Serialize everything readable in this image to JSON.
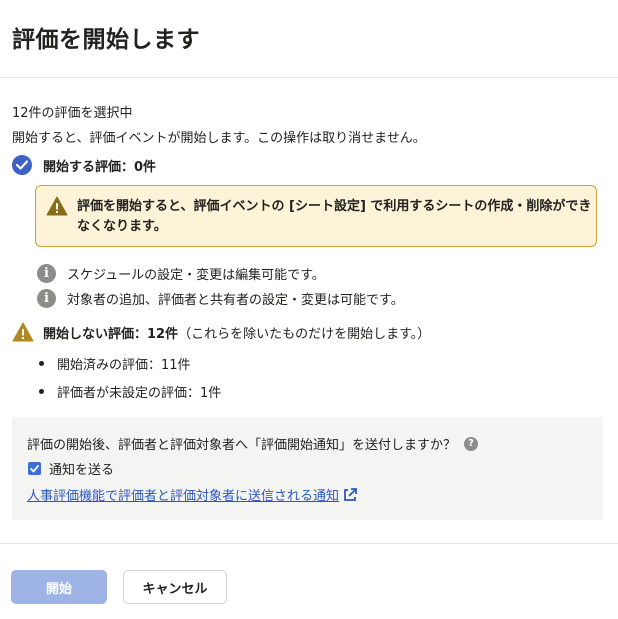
{
  "dialog": {
    "title": "評価を開始します"
  },
  "summary": {
    "selected": "12件の評価を選択中",
    "description": "開始すると、評価イベントが開始します。この操作は取り消せません。"
  },
  "start_section": {
    "label": "開始する評価：0件",
    "alert": "評価を開始すると、評価イベントの [シート設定] で利用するシートの作成・削除ができなくなります。",
    "notes": [
      "スケジュールの設定・変更は編集可能です。",
      "対象者の追加、評価者と共有者の設定・変更は可能です。"
    ]
  },
  "skip_section": {
    "label": "開始しない評価：12件",
    "note": "（これらを除いたものだけを開始します。）",
    "items": [
      "開始済みの評価：11件",
      "評価者が未設定の評価：1件"
    ]
  },
  "notify": {
    "question": "評価の開始後、評価者と評価対象者へ「評価開始通知」を送付しますか？",
    "checkbox_label": "通知を送る",
    "checked": true,
    "link_text": "人事評価機能で評価者と評価対象者に送信される通知"
  },
  "footer": {
    "start_label": "開始",
    "cancel_label": "キャンセル"
  },
  "colors": {
    "accent": "#3d62c3",
    "primary_disabled": "#9fb4e6",
    "warning_bg": "#fdf3d8",
    "warning_border": "#cfa338",
    "link": "#2c57c0"
  },
  "icons": {
    "start": "check-circle-icon",
    "alert": "warning-triangle-icon",
    "notes": "info-circle-icon",
    "skip": "warning-triangle-icon",
    "help": "question-circle-icon",
    "external": "external-link-icon"
  }
}
